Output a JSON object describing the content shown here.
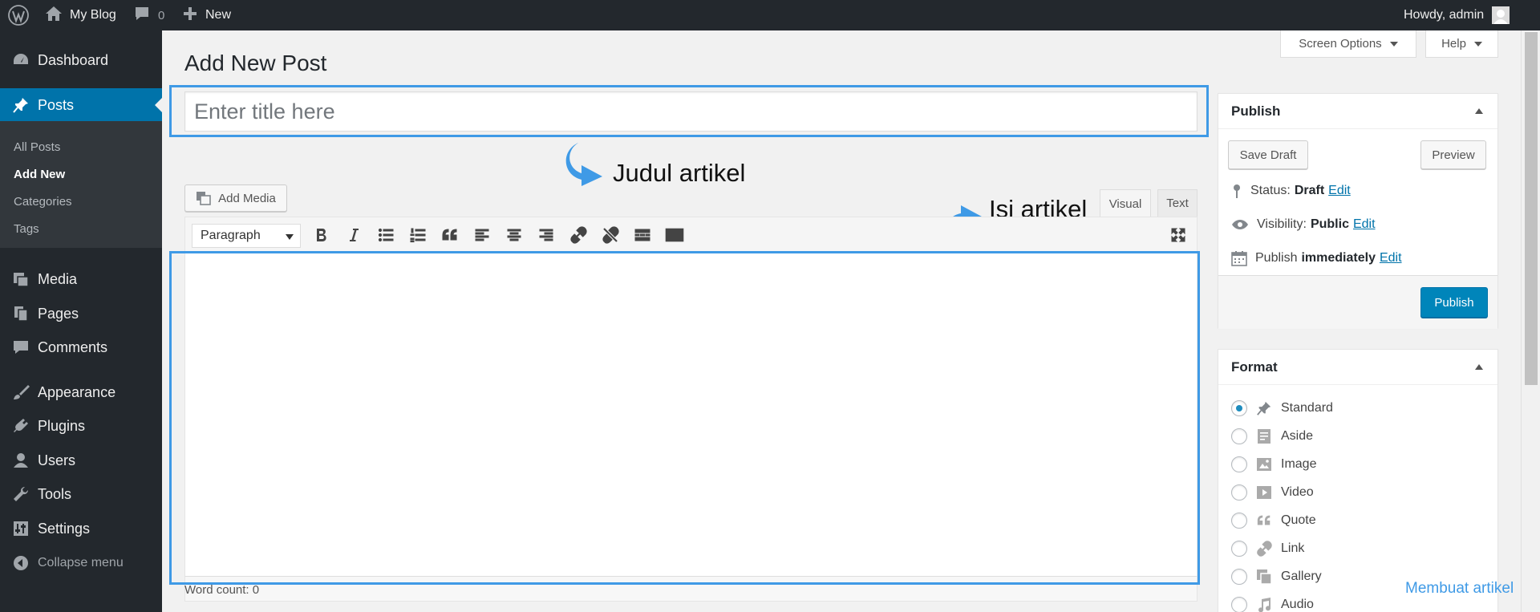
{
  "adminbar": {
    "site_name": "My Blog",
    "comments_count": "0",
    "new_label": "New",
    "greeting": "Howdy, admin"
  },
  "sidebar": {
    "items": [
      {
        "label": "Dashboard",
        "icon": "dashboard-icon"
      },
      {
        "label": "Posts",
        "icon": "pin-icon"
      },
      {
        "label": "Media",
        "icon": "media-icon"
      },
      {
        "label": "Pages",
        "icon": "pages-icon"
      },
      {
        "label": "Comments",
        "icon": "comment-icon"
      },
      {
        "label": "Appearance",
        "icon": "brush-icon"
      },
      {
        "label": "Plugins",
        "icon": "plug-icon"
      },
      {
        "label": "Users",
        "icon": "user-icon"
      },
      {
        "label": "Tools",
        "icon": "wrench-icon"
      },
      {
        "label": "Settings",
        "icon": "settings-icon"
      },
      {
        "label": "Collapse menu",
        "icon": "collapse-icon"
      }
    ],
    "submenu": [
      "All Posts",
      "Add New",
      "Categories",
      "Tags"
    ]
  },
  "screen_options": {
    "label": "Screen Options",
    "help_label": "Help"
  },
  "page": {
    "title": "Add New Post",
    "title_placeholder": "Enter title here"
  },
  "annotations": {
    "title_label": "Judul artikel",
    "body_label": "Isi artikel",
    "caption": "Membuat artikel",
    "color": "#3f9ae6"
  },
  "editor": {
    "add_media": "Add Media",
    "tab_visual": "Visual",
    "tab_text": "Text",
    "format_select": "Paragraph",
    "word_count": "Word count: 0"
  },
  "publish": {
    "title": "Publish",
    "save_draft": "Save Draft",
    "preview": "Preview",
    "status_label": "Status:",
    "status_value": "Draft",
    "visibility_label": "Visibility:",
    "visibility_value": "Public",
    "schedule_label": "Publish",
    "schedule_value": "immediately",
    "edit_link": "Edit",
    "publish_button": "Publish",
    "accent": "#0085ba"
  },
  "format": {
    "title": "Format",
    "options": [
      "Standard",
      "Aside",
      "Image",
      "Video",
      "Quote",
      "Link",
      "Gallery",
      "Audio"
    ],
    "selected": "Standard"
  }
}
